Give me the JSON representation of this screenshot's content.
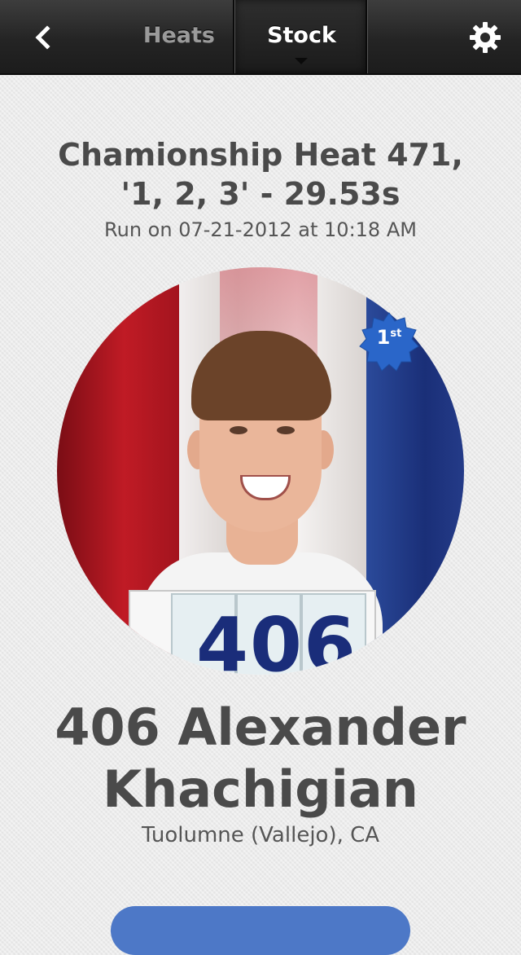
{
  "nav": {
    "back_icon": "chevron-left-icon",
    "heats_label": "Heats",
    "stock_label": "Stock",
    "settings_icon": "gear-icon"
  },
  "heat": {
    "title_line1": "Chamionship Heat 471,",
    "title_line2": "'1, 2, 3' - 29.53s",
    "run_info": "Run on 07-21-2012 at 10:18 AM"
  },
  "racer": {
    "bib_number": "406",
    "place_number": "1",
    "place_suffix": "st",
    "name_line1": "406 Alexander",
    "name_line2": "Khachigian",
    "location": "Tuolumne (Vallejo), CA"
  },
  "colors": {
    "accent": "#4d78c7",
    "badge": "#2a66c9",
    "topbar": "#242424"
  }
}
